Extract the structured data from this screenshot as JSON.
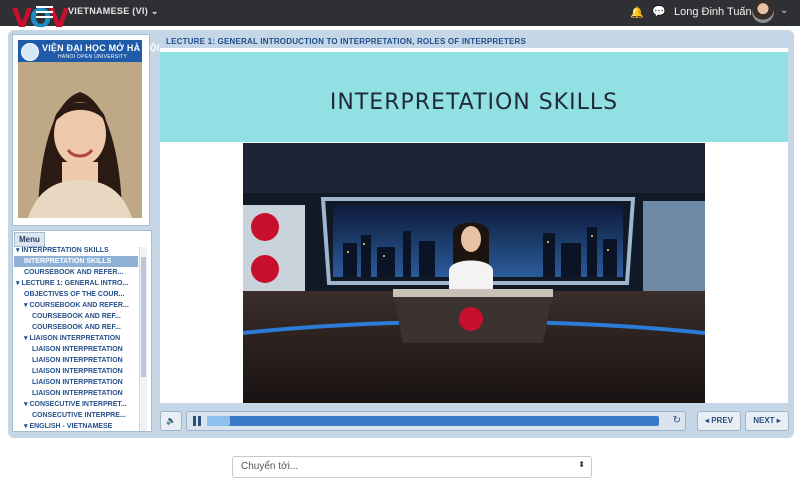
{
  "topbar": {
    "logo_text": "VOV",
    "language": "VIETNAMESE (VI)",
    "language_caret": "⌄",
    "bell_icon": "🔔",
    "chat_icon": "💬",
    "user_name": "Long Đinh Tuấn",
    "user_caret": "⌄"
  },
  "sidebar": {
    "org_name": "VIỆN ĐẠI HỌC MỞ HÀ NỘI",
    "org_sub": "HANOI OPEN UNIVERSITY",
    "menu_tab": "Menu",
    "menu_items": [
      {
        "label": "▾ INTERPRETATION SKILLS",
        "indent": 0,
        "active": false
      },
      {
        "label": "INTERPRETATION SKILLS",
        "indent": 1,
        "active": true
      },
      {
        "label": "COURSEBOOK AND REFER...",
        "indent": 1,
        "active": false
      },
      {
        "label": "▾ LECTURE 1: GENERAL INTRO...",
        "indent": 0,
        "active": false
      },
      {
        "label": "OBJECTIVES OF THE COUR...",
        "indent": 1,
        "active": false
      },
      {
        "label": "▾ COURSEBOOK AND REFER...",
        "indent": 1,
        "active": false
      },
      {
        "label": "COURSEBOOK AND REF...",
        "indent": 2,
        "active": false
      },
      {
        "label": "COURSEBOOK AND REF...",
        "indent": 2,
        "active": false
      },
      {
        "label": "▾ LIAISON INTERPRETATION",
        "indent": 1,
        "active": false
      },
      {
        "label": "LIAISON INTERPRETATION",
        "indent": 2,
        "active": false
      },
      {
        "label": "LIAISON INTERPRETATION",
        "indent": 2,
        "active": false
      },
      {
        "label": "LIAISON INTERPRETATION",
        "indent": 2,
        "active": false
      },
      {
        "label": "LIAISON INTERPRETATION",
        "indent": 2,
        "active": false
      },
      {
        "label": "LIAISON INTERPRETATION",
        "indent": 2,
        "active": false
      },
      {
        "label": "▾ CONSECUTIVE INTERPRET...",
        "indent": 1,
        "active": false
      },
      {
        "label": "CONSECUTIVE INTERPRE...",
        "indent": 2,
        "active": false
      },
      {
        "label": "▾ ENGLISH - VIETNAMESE",
        "indent": 1,
        "active": false
      }
    ]
  },
  "main": {
    "lecture_title": "LECTURE 1: GENERAL INTRODUCTION TO INTERPRETATION, ROLES OF INTERPRETERS",
    "slide_title": "INTERPRETATION SKILLS"
  },
  "controls": {
    "volume_icon": "🔈",
    "replay_icon": "↻",
    "prev_label": "◂ PREV",
    "next_label": "NEXT ▸",
    "progress_fraction": 0.05
  },
  "footer": {
    "jump_label": "Chuyển tới...",
    "jump_arrows": "⬍"
  }
}
